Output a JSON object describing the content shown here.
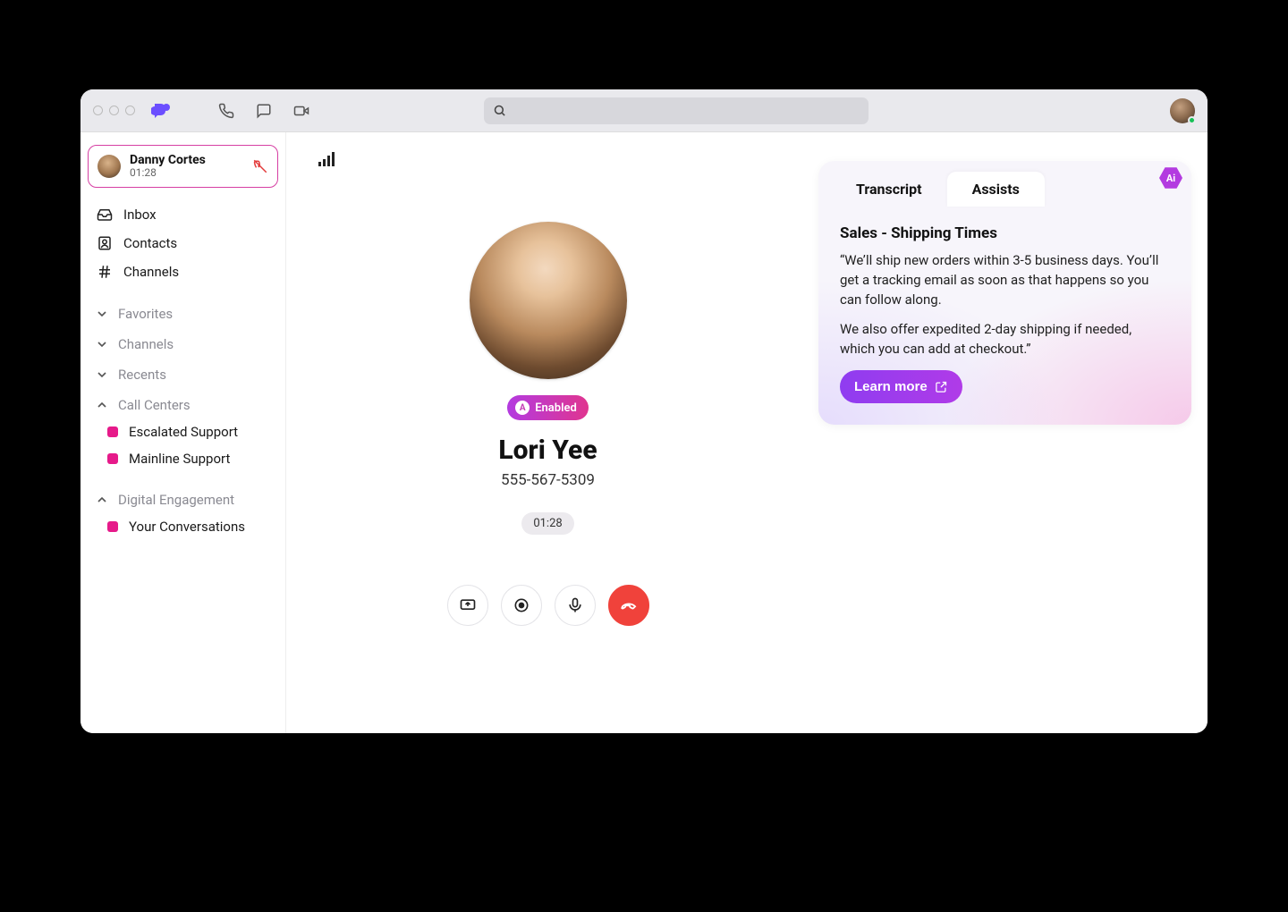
{
  "titlebar": {
    "search_placeholder": ""
  },
  "sidebar": {
    "activeCall": {
      "name": "Danny Cortes",
      "duration": "01:28"
    },
    "nav": [
      {
        "icon": "inbox",
        "label": "Inbox"
      },
      {
        "icon": "contacts",
        "label": "Contacts"
      },
      {
        "icon": "hash",
        "label": "Channels"
      }
    ],
    "sections": [
      {
        "label": "Favorites",
        "expanded": false,
        "items": []
      },
      {
        "label": "Channels",
        "expanded": false,
        "items": []
      },
      {
        "label": "Recents",
        "expanded": false,
        "items": []
      },
      {
        "label": "Call Centers",
        "expanded": true,
        "items": [
          {
            "label": "Escalated Support"
          },
          {
            "label": "Mainline Support"
          }
        ]
      },
      {
        "label": "Digital Engagement",
        "expanded": true,
        "items": [
          {
            "label": "Your Conversations"
          }
        ]
      }
    ]
  },
  "call": {
    "enabled_label": "Enabled",
    "name": "Lori Yee",
    "phone": "555-567-5309",
    "duration": "01:28"
  },
  "assist": {
    "tabs": {
      "transcript": "Transcript",
      "assists": "Assists"
    },
    "active_tab": "assists",
    "ai_badge": "Ai",
    "card": {
      "title": "Sales - Shipping Times",
      "para1": "“We’ll ship new orders within 3-5 business days. You’ll get a tracking email as soon as that happens so you can follow along.",
      "para2": "We also offer expedited 2-day shipping if needed, which you can add at checkout.”",
      "cta": "Learn more"
    }
  },
  "colors": {
    "brand": "#6b4eff",
    "accent_pink": "#e61a8a",
    "hangup": "#f0423b"
  }
}
